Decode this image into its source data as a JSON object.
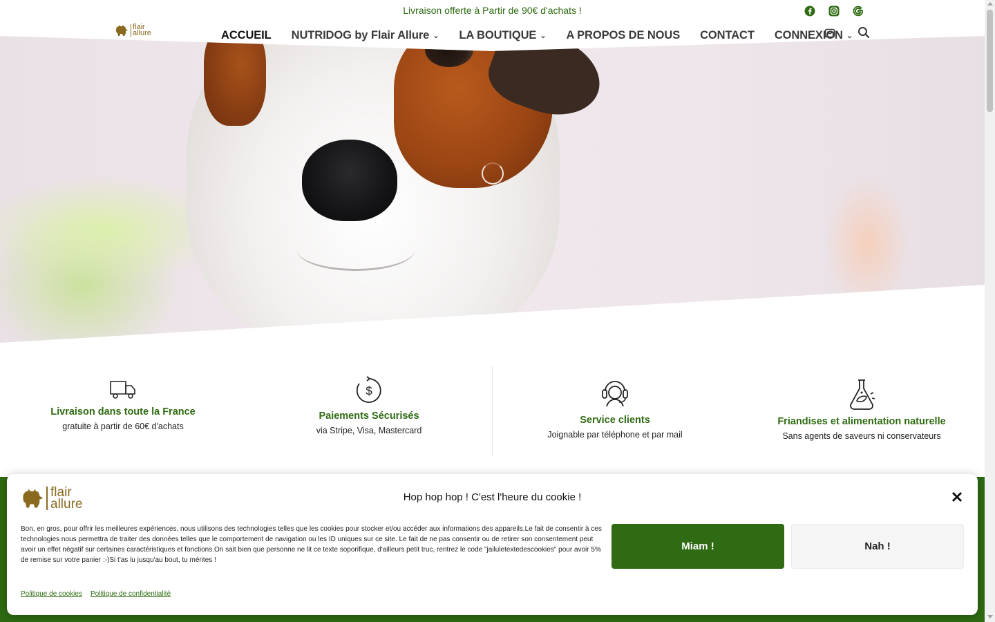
{
  "topbar": {
    "promo": "Livraison offerte à Partir de 90€ d'achats !",
    "socials": [
      "facebook-icon",
      "instagram-icon",
      "google-icon"
    ]
  },
  "header": {
    "logo": {
      "line1": "flair",
      "line2": "allure"
    },
    "nav": [
      {
        "label": "ACCUEIL",
        "active": true,
        "dropdown": false
      },
      {
        "label": "NUTRIDOG by Flair Allure",
        "active": false,
        "dropdown": true
      },
      {
        "label": "LA BOUTIQUE",
        "active": false,
        "dropdown": true
      },
      {
        "label": "A PROPOS DE NOUS",
        "active": false,
        "dropdown": false
      },
      {
        "label": "CONTACT",
        "active": false,
        "dropdown": false
      },
      {
        "label": "CONNEXION",
        "active": false,
        "dropdown": true
      }
    ],
    "icons": [
      "cart-icon",
      "search-icon"
    ]
  },
  "features": [
    {
      "icon": "truck-icon",
      "title": "Livraison dans toute la France",
      "subtitle": "gratuite à partir de 60€ d'achats"
    },
    {
      "icon": "payment-icon",
      "title": "Paiements Sécurisés",
      "subtitle": "via Stripe, Visa, Mastercard"
    },
    {
      "icon": "headset-icon",
      "title": "Service clients",
      "subtitle": "Joignable par téléphone et par mail"
    },
    {
      "icon": "flask-leaf-icon",
      "title": "Friandises et alimentation naturelle",
      "subtitle": "Sans agents de saveurs ni conservateurs"
    }
  ],
  "cookie": {
    "logo": {
      "line1": "flair",
      "line2": "allure"
    },
    "title": "Hop hop hop ! C'est l'heure du cookie !",
    "text": "Bon, en gros, pour offrir les meilleures expériences, nous utilisons des technologies telles que les cookies pour stocker et/ou accéder aux informations des appareils.Le fait de consentir à ces technologies nous permettra de traiter des données telles que le comportement de navigation ou les ID uniques sur ce site. Le fait de ne pas consentir ou de retirer son consentement peut avoir un effet négatif sur certaines caractéristiques et fonctions.On sait bien que personne ne lit ce texte soporifique, d'ailleurs petit truc, rentrez le code \"jailuletextedescookies\" pour avoir 5% de remise sur votre panier :-)Si t'as lu jusqu'au bout, tu mérites !",
    "accept_label": "Miam !",
    "deny_label": "Nah !",
    "links": [
      "Politique de cookies",
      "Politique de confidentialité"
    ]
  },
  "colors": {
    "brand_green": "#2e6b12",
    "logo_gold": "#8a6a1e"
  }
}
